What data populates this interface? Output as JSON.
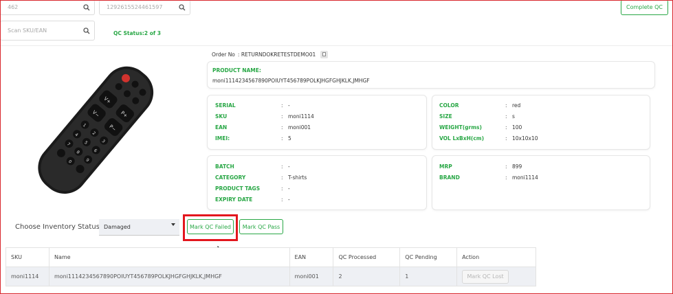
{
  "search": {
    "field1_placeholder": "462",
    "field2_placeholder": "1292615524461597",
    "scan_placeholder": "Scan SKU/EAN"
  },
  "qc_status": "QC Status:2 of 3",
  "complete_qc_label": "Complete QC",
  "order": {
    "label": "Order No",
    "value": ": RETURNDOKRETESTDEMO01"
  },
  "product": {
    "name_label": "PRODUCT NAME:",
    "name_value": "moni1114234567890POIUYT456789POLKJHGFGHJKLK,JMHGF"
  },
  "details_left": [
    {
      "key": "SERIAL",
      "value": "-"
    },
    {
      "key": "SKU",
      "value": "moni1114"
    },
    {
      "key": "EAN",
      "value": "moni001"
    },
    {
      "key": "IMEI:",
      "value": "5"
    }
  ],
  "details_right": [
    {
      "key": "COLOR",
      "value": "red"
    },
    {
      "key": "SIZE",
      "value": "s"
    },
    {
      "key": "WEIGHT(grms)",
      "value": "100"
    },
    {
      "key": "VOL LxBxH(cm)",
      "value": "10x10x10"
    }
  ],
  "batch_left": [
    {
      "key": "BATCH",
      "value": "-"
    },
    {
      "key": "CATEGORY",
      "value": "T-shirts"
    },
    {
      "key": "PRODUCT TAGS",
      "value": "-"
    },
    {
      "key": "EXPIRY DATE",
      "value": "-"
    }
  ],
  "batch_right": [
    {
      "key": "MRP",
      "value": "899"
    },
    {
      "key": "BRAND",
      "value": "moni1114"
    }
  ],
  "inventory": {
    "label": "Choose Inventory Status",
    "selected": "Damaged"
  },
  "buttons": {
    "mark_failed": "Mark QC Failed",
    "mark_pass": "Mark QC Pass"
  },
  "table": {
    "headers": [
      "SKU",
      "Name",
      "EAN",
      "QC Processed",
      "QC Pending",
      "Action"
    ],
    "rows": [
      {
        "sku": "moni1114",
        "name": "moni1114234567890POIUYT456789POLKJHGFGHJKLK,JMHGF",
        "ean": "moni001",
        "processed": "2",
        "pending": "1",
        "action": "Mark QC Lost"
      }
    ]
  },
  "colors": {
    "accent_green": "#28a745",
    "highlight_red": "#e3161d"
  }
}
